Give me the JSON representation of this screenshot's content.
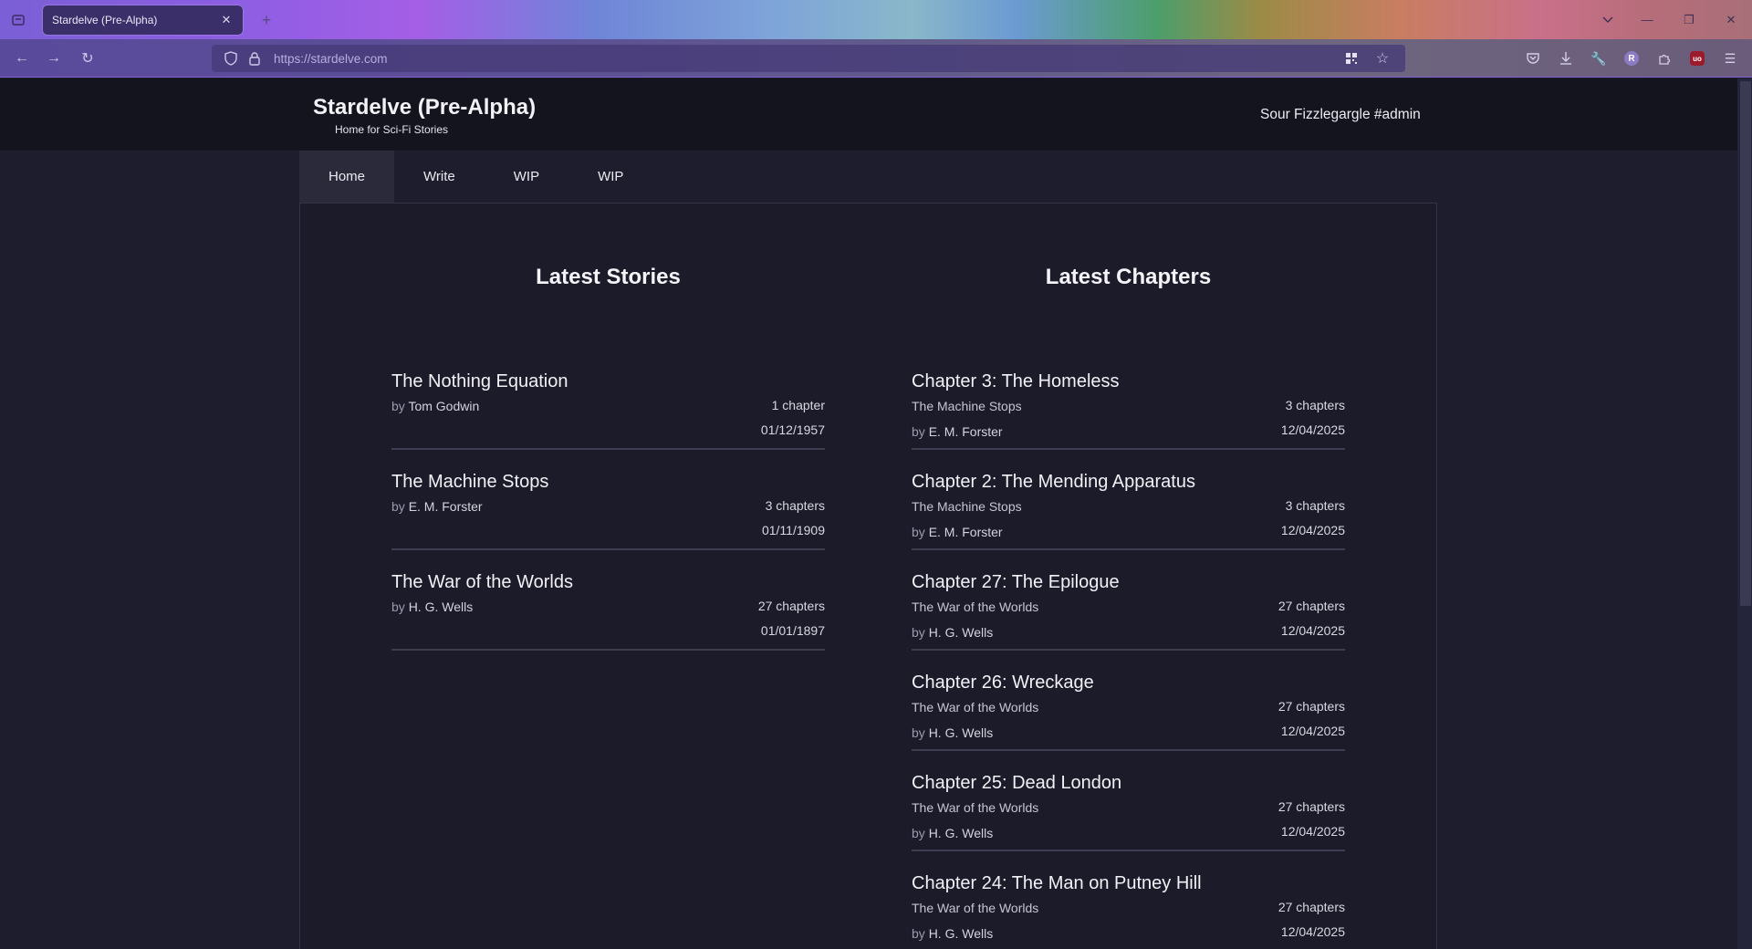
{
  "browser": {
    "tab_title": "Stardelve (Pre-Alpha)",
    "tab_close": "✕",
    "new_tab": "+",
    "url": "https://stardelve.com",
    "minimize": "—",
    "restore": "❐",
    "close": "✕"
  },
  "site": {
    "title": "Stardelve (Pre-Alpha)",
    "subtitle": "Home for Sci-Fi Stories",
    "user": "Sour Fizzlegargle #admin"
  },
  "nav": {
    "items": [
      {
        "label": "Home"
      },
      {
        "label": "Write"
      },
      {
        "label": "WIP"
      },
      {
        "label": "WIP"
      }
    ]
  },
  "stories": {
    "title": "Latest Stories",
    "items": [
      {
        "title": "The Nothing Equation",
        "by": "by",
        "author": "Tom Godwin",
        "chapters": "1 chapter",
        "date": "01/12/1957"
      },
      {
        "title": "The Machine Stops",
        "by": "by",
        "author": "E. M. Forster",
        "chapters": "3 chapters",
        "date": "01/11/1909"
      },
      {
        "title": "The War of the Worlds",
        "by": "by",
        "author": "H. G. Wells",
        "chapters": "27 chapters",
        "date": "01/01/1897"
      }
    ]
  },
  "chapters": {
    "title": "Latest Chapters",
    "items": [
      {
        "title": "Chapter 3: The Homeless",
        "story": "The Machine Stops",
        "by": "by",
        "author": "E. M. Forster",
        "chapters": "3 chapters",
        "date": "12/04/2025"
      },
      {
        "title": "Chapter 2: The Mending Apparatus",
        "story": "The Machine Stops",
        "by": "by",
        "author": "E. M. Forster",
        "chapters": "3 chapters",
        "date": "12/04/2025"
      },
      {
        "title": "Chapter 27: The Epilogue",
        "story": "The War of the Worlds",
        "by": "by",
        "author": "H. G. Wells",
        "chapters": "27 chapters",
        "date": "12/04/2025"
      },
      {
        "title": "Chapter 26: Wreckage",
        "story": "The War of the Worlds",
        "by": "by",
        "author": "H. G. Wells",
        "chapters": "27 chapters",
        "date": "12/04/2025"
      },
      {
        "title": "Chapter 25: Dead London",
        "story": "The War of the Worlds",
        "by": "by",
        "author": "H. G. Wells",
        "chapters": "27 chapters",
        "date": "12/04/2025"
      },
      {
        "title": "Chapter 24: The Man on Putney Hill",
        "story": "The War of the Worlds",
        "by": "by",
        "author": "H. G. Wells",
        "chapters": "27 chapters",
        "date": "12/04/2025"
      }
    ]
  },
  "colors": {
    "page_bg": "#1e1d2d",
    "header_bg": "#14141f",
    "active_tab_bg": "#2a2a3b"
  }
}
